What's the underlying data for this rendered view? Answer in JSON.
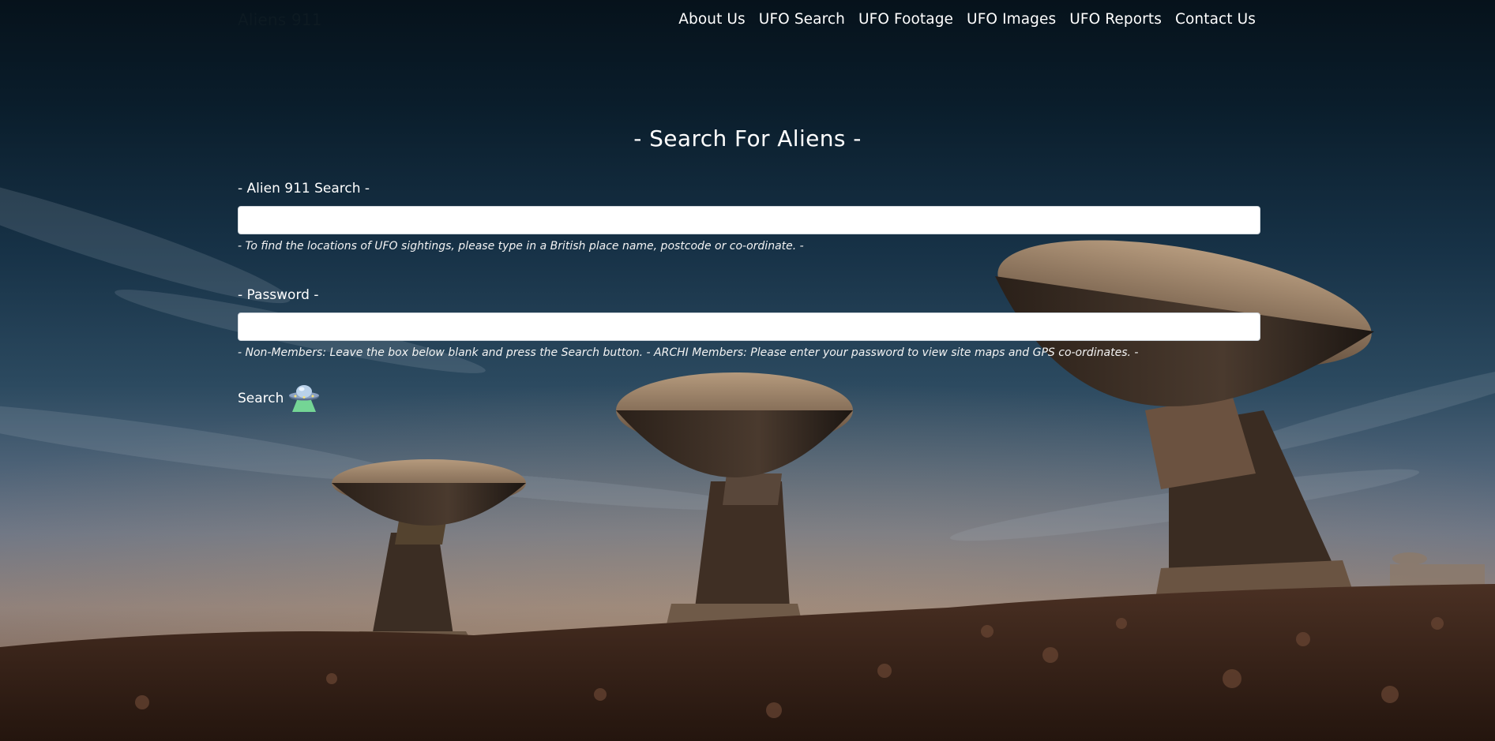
{
  "header": {
    "brand": "Aliens 911",
    "nav": [
      {
        "label": "About Us"
      },
      {
        "label": "UFO Search"
      },
      {
        "label": "UFO Footage"
      },
      {
        "label": "UFO Images"
      },
      {
        "label": "UFO Reports"
      },
      {
        "label": "Contact Us"
      }
    ]
  },
  "main": {
    "title": "- Search For Aliens -",
    "search": {
      "label": "- Alien 911 Search -",
      "value": "",
      "help": "- To find the locations of UFO sightings, please type in a British place name, postcode or co-ordinate. -"
    },
    "password": {
      "label": "- Password -",
      "value": "",
      "help": "- Non-Members: Leave the box below blank and press the Search button. - ARCHI Members: Please enter your password to view site maps and GPS co-ordinates. -"
    },
    "submit": {
      "label": "Search",
      "icon": "ufo-icon"
    }
  },
  "background": {
    "icon": "radio-telescope-scene",
    "colors": {
      "sky_top": "#06121b",
      "horizon": "#8a7d7a",
      "ground": "#3a2418"
    }
  }
}
